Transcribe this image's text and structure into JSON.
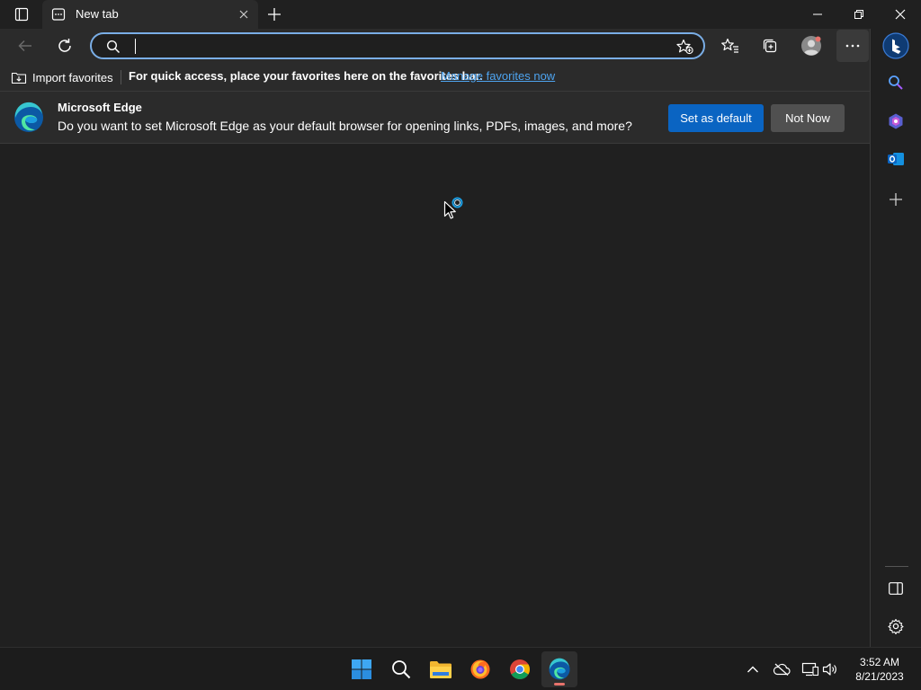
{
  "tab": {
    "title": "New tab"
  },
  "address_bar": {
    "value": "",
    "placeholder": ""
  },
  "favorites_bar": {
    "import_label": "Import favorites",
    "hint": "For quick access, place your favorites here on the favorites bar.",
    "manage_link": "Manage favorites now"
  },
  "infobar": {
    "title": "Microsoft Edge",
    "message": "Do you want to set Microsoft Edge as your default browser for opening links, PDFs, images, and more?",
    "set_default_label": "Set as default",
    "not_now_label": "Not Now"
  },
  "taskbar": {
    "time": "3:52 AM",
    "date": "8/21/2023",
    "apps": [
      "windows-start-icon",
      "search-icon",
      "file-explorer-icon",
      "firefox-icon",
      "chrome-icon",
      "edge-icon"
    ]
  },
  "colors": {
    "accent": "#0a64c2",
    "link": "#4ea4f0",
    "focus_ring": "#7aaee6",
    "background": "#202020",
    "toolbar": "#2b2b2b"
  }
}
